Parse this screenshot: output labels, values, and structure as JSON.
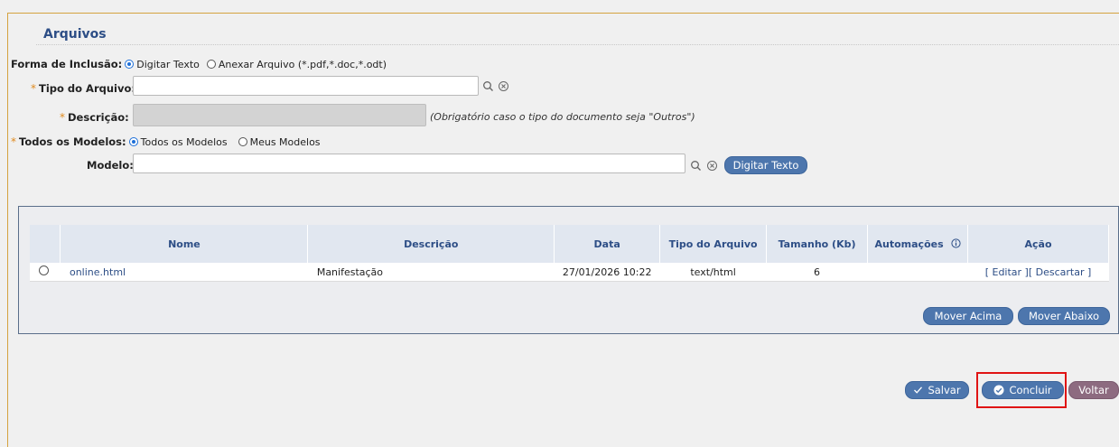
{
  "section": {
    "title": "Arquivos"
  },
  "form": {
    "inclusion_label": "Forma de Inclusão:",
    "inclusion_opt1": "Digitar Texto",
    "inclusion_opt2": "Anexar Arquivo (*.pdf,*.doc,*.odt)",
    "required_mark": "*",
    "tipo_label": "Tipo do Arquivo:",
    "tipo_value": "",
    "descricao_label": "Descrição:",
    "descricao_hint": "(Obrigatório caso o tipo do documento seja \"Outros\")",
    "todos_label": "Todos os Modelos:",
    "todos_opt1": "Todos os Modelos",
    "todos_opt2": "Meus Modelos",
    "modelo_label": "Modelo:",
    "modelo_value": "",
    "digitar_texto_btn": "Digitar Texto"
  },
  "icons": {
    "search": "search-icon",
    "clear": "clear-icon",
    "info": "info-icon",
    "check": "check-icon",
    "check-circle": "check-circle-icon"
  },
  "table": {
    "headers": [
      "",
      "Nome",
      "Descrição",
      "Data",
      "Tipo do Arquivo",
      "Tamanho (Kb)",
      "Automações",
      "Ação"
    ],
    "rows": [
      {
        "nome": "online.html",
        "descricao": "Manifestação",
        "data": "27/01/2026 10:22",
        "tipo": "text/html",
        "tamanho": "6",
        "automacoes": "",
        "acao_editar": "[ Editar ]",
        "acao_descartar": "[ Descartar ]"
      }
    ]
  },
  "buttons": {
    "mover_acima": "Mover Acima",
    "mover_abaixo": "Mover Abaixo",
    "salvar": "Salvar",
    "concluir": "Concluir",
    "voltar": "Voltar"
  },
  "colors": {
    "accent": "#4d76ad",
    "header_text": "#2d4e86",
    "voltar": "#8d6b80",
    "highlight": "#e01414",
    "frame": "#d4a240"
  }
}
